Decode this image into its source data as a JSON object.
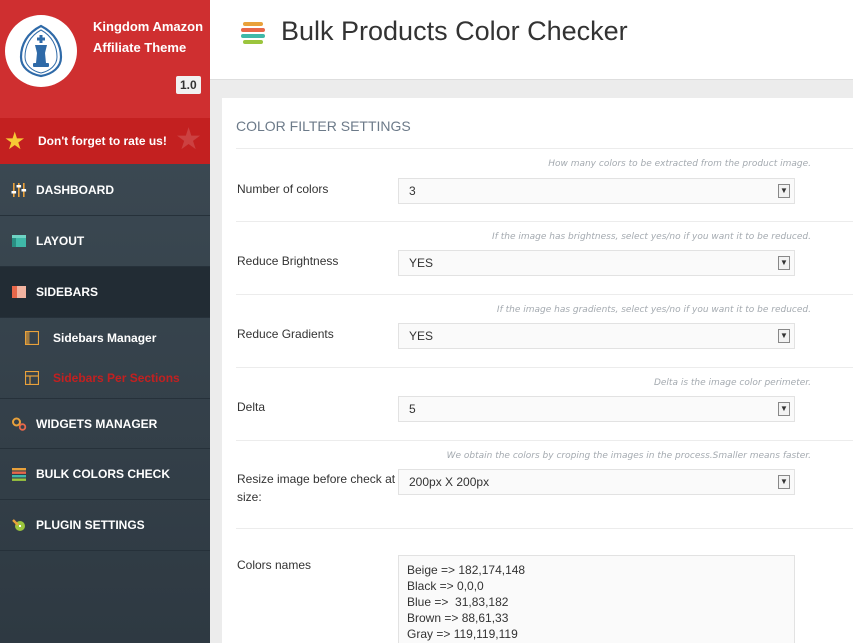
{
  "brand": {
    "name": "Kingdom Amazon Affiliate Theme",
    "version": "1.0",
    "logo_icon": "chess-king-logo-icon"
  },
  "rate": {
    "text": "Don't forget to rate us!",
    "icon": "star-icon"
  },
  "nav": {
    "items": [
      {
        "label": "DASHBOARD",
        "icon": "sliders-icon"
      },
      {
        "label": "LAYOUT",
        "icon": "layout-icon"
      },
      {
        "label": "SIDEBARS",
        "icon": "sidebars-icon"
      },
      {
        "label": "WIDGETS MANAGER",
        "icon": "gears-icon"
      },
      {
        "label": "BULK COLORS CHECK",
        "icon": "stripes-icon"
      },
      {
        "label": "PLUGIN SETTINGS",
        "icon": "plugin-icon"
      }
    ],
    "sub_items": [
      {
        "label": "Sidebars Manager"
      },
      {
        "label": "Sidebars Per Sections"
      }
    ]
  },
  "header": {
    "title": "Bulk Products Color Checker"
  },
  "panel": {
    "title": "COLOR FILTER SETTINGS",
    "rows": [
      {
        "hint": "How many colors to be extracted from the product image.",
        "label": "Number of colors",
        "value": "3"
      },
      {
        "hint": "If the image has brightness, select yes/no if you want it to be reduced.",
        "label": "Reduce Brightness",
        "value": "YES"
      },
      {
        "hint": "If the image has gradients, select yes/no if you want it to be reduced.",
        "label": "Reduce Gradients",
        "value": "YES"
      },
      {
        "hint": "Delta is the image color perimeter.",
        "label": "Delta",
        "value": "5"
      },
      {
        "hint": "We obtain the colors by croping the images in the process.Smaller means faster.",
        "label": "Resize image before check at size:",
        "value": "200px X 200px"
      }
    ],
    "colors_label": "Colors names",
    "colors": [
      "Beige => 182,174,148",
      "Black => 0,0,0",
      "Blue =>  31,83,182",
      "Brown => 88,61,33",
      "Gray => 119,119,119"
    ]
  },
  "colors": {
    "brand_red": "#cf2f30",
    "rate_red": "#c32020",
    "sidebar_dark": "#3f4d57",
    "active_sub": "#c32020"
  }
}
